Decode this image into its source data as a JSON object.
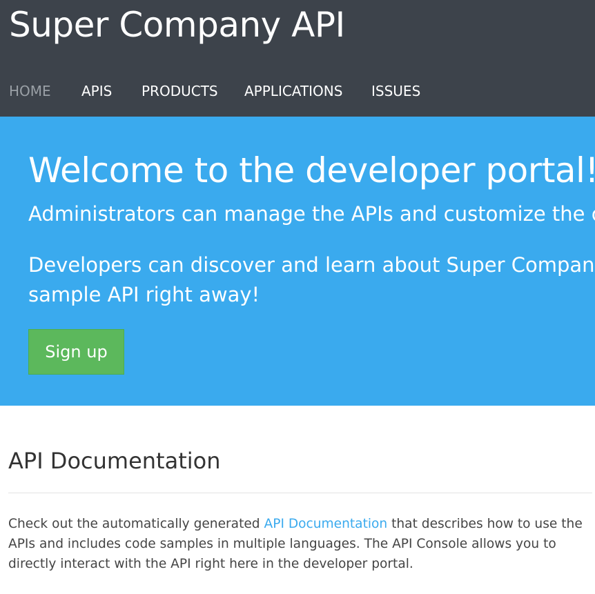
{
  "header": {
    "site_title": "Super Company API",
    "nav": {
      "home": "HOME",
      "apis": "APIS",
      "products": "PRODUCTS",
      "applications": "APPLICATIONS",
      "issues": "ISSUES"
    },
    "active_item": "HOME"
  },
  "hero": {
    "title": "Welcome to the developer portal!",
    "line_admin": "Administrators can manage the APIs and customize the con",
    "line_dev_1": "Developers can discover and learn about Super Company A",
    "line_dev_2": "sample API right away!",
    "signup_label": "Sign up"
  },
  "documentation": {
    "title": "API Documentation",
    "text_1a": "Check out the automatically generated ",
    "link": "API Documentation",
    "text_1b": " that describes how to use the",
    "text_2": "APIs and includes code samples in multiple languages. The API Console allows you to",
    "text_3": "directly interact with the API right here in the developer portal."
  },
  "colors": {
    "header_bg": "#3d434b",
    "hero_bg": "#3aaaee",
    "signup_bg": "#5cb85c",
    "link": "#3aaaee",
    "nav_active": "#9aa0a6"
  }
}
